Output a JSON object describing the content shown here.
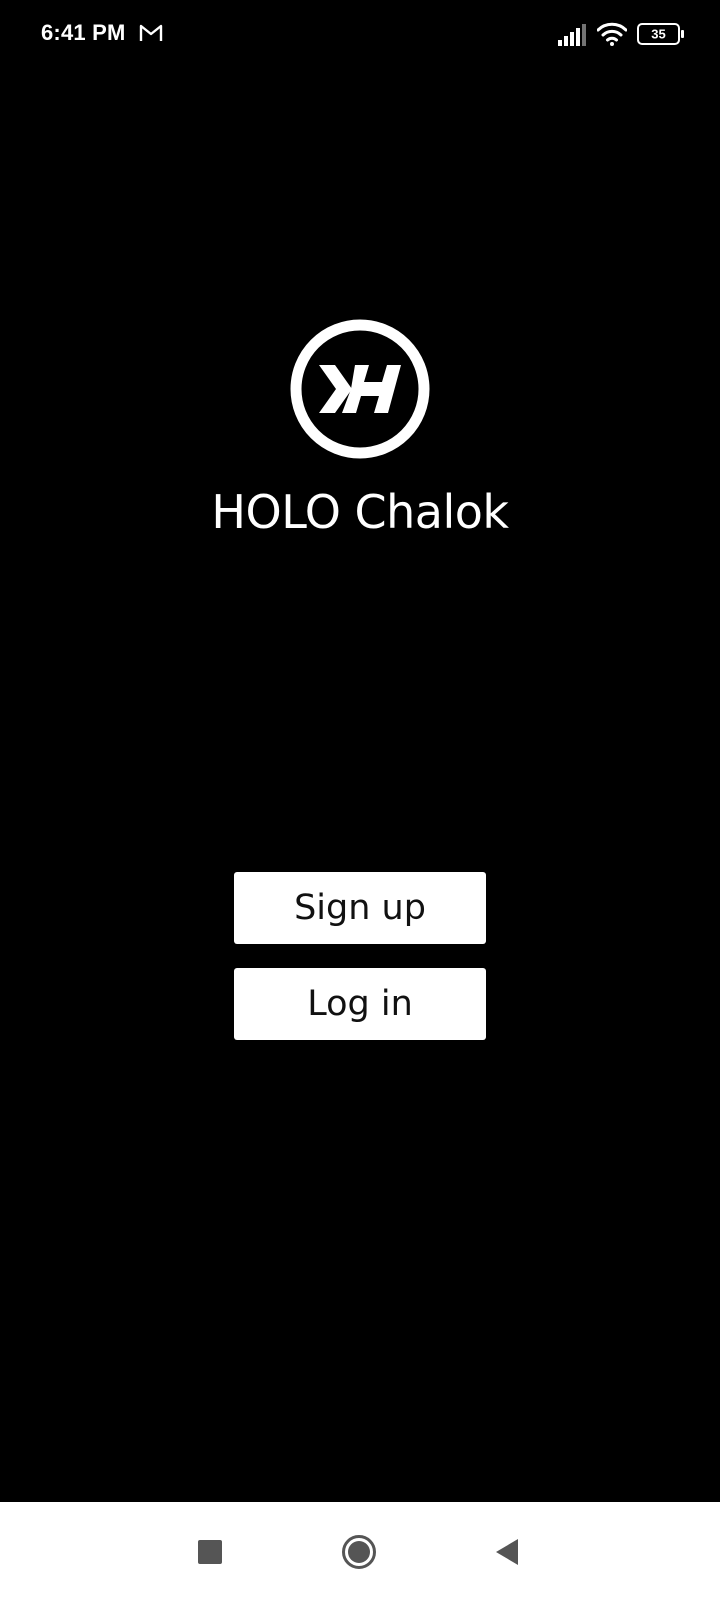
{
  "status_bar": {
    "time": "6:41 PM",
    "battery_level": "35",
    "icons": [
      "gmail-icon",
      "signal-icon",
      "wifi-icon",
      "battery-icon"
    ]
  },
  "app": {
    "name": "HOLO Chalok",
    "logo": "holo-logo-icon"
  },
  "auth": {
    "signup_label": "Sign up",
    "login_label": "Log in"
  },
  "nav_bar": {
    "icons": [
      "recents-square-icon",
      "home-circle-icon",
      "back-triangle-icon"
    ]
  },
  "colors": {
    "background": "#000000",
    "button_background": "#ffffff",
    "button_text": "#111111",
    "nav_bar_background": "#ffffff",
    "nav_icon": "#555555"
  }
}
